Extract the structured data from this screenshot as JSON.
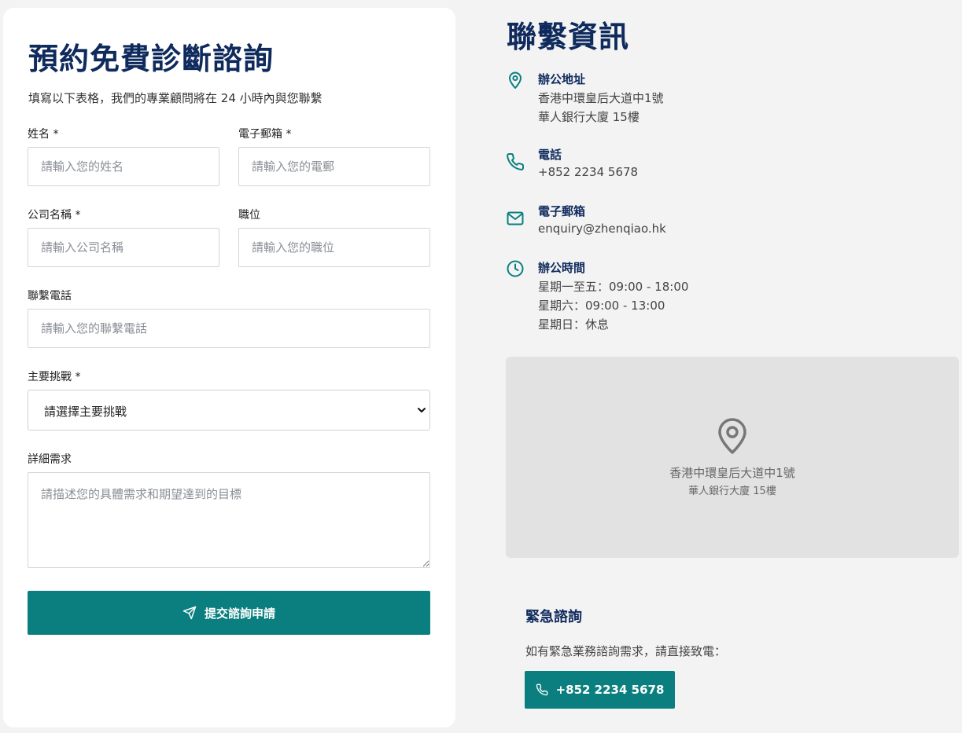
{
  "form": {
    "title": "預約免費診斷諮詢",
    "subtitle": "填寫以下表格，我們的專業顧問將在 24 小時內與您聯繫",
    "fields": {
      "name": {
        "label": "姓名 *",
        "placeholder": "請輸入您的姓名"
      },
      "email": {
        "label": "電子郵箱 *",
        "placeholder": "請輸入您的電郵"
      },
      "company": {
        "label": "公司名稱 *",
        "placeholder": "請輸入公司名稱"
      },
      "position": {
        "label": "職位",
        "placeholder": "請輸入您的職位"
      },
      "phone": {
        "label": "聯繫電話",
        "placeholder": "請輸入您的聯繫電話"
      },
      "challenge": {
        "label": "主要挑戰 *",
        "selected": "請選擇主要挑戰"
      },
      "details": {
        "label": "詳細需求",
        "placeholder": "請描述您的具體需求和期望達到的目標"
      }
    },
    "submit_label": "提交諮詢申請"
  },
  "contact": {
    "title": "聯繫資訊",
    "address": {
      "heading": "辦公地址",
      "line1": "香港中環皇后大道中1號",
      "line2": "華人銀行大廈 15樓"
    },
    "phone": {
      "heading": "電話",
      "value": "+852 2234 5678"
    },
    "email": {
      "heading": "電子郵箱",
      "value": "enquiry@zhenqiao.hk"
    },
    "hours": {
      "heading": "辦公時間",
      "weekdays": "星期一至五：09:00 - 18:00",
      "saturday": "星期六：09:00 - 13:00",
      "sunday": "星期日：休息"
    }
  },
  "map": {
    "line1": "香港中環皇后大道中1號",
    "line2": "華人銀行大廈 15樓"
  },
  "urgent": {
    "title": "緊急諮詢",
    "description": "如有緊急業務諮詢需求，請直接致電：",
    "phone_label": "+852 2234 5678"
  },
  "colors": {
    "primary": "#0b7f7f",
    "heading": "#0f2a5c",
    "page_bg": "#f3f3f3",
    "map_bg": "#e2e2e2"
  },
  "icons": {
    "address": "map-pin-icon",
    "phone": "phone-icon",
    "email": "mail-icon",
    "hours": "clock-icon",
    "submit": "send-icon",
    "select": "chevron-down-icon"
  }
}
